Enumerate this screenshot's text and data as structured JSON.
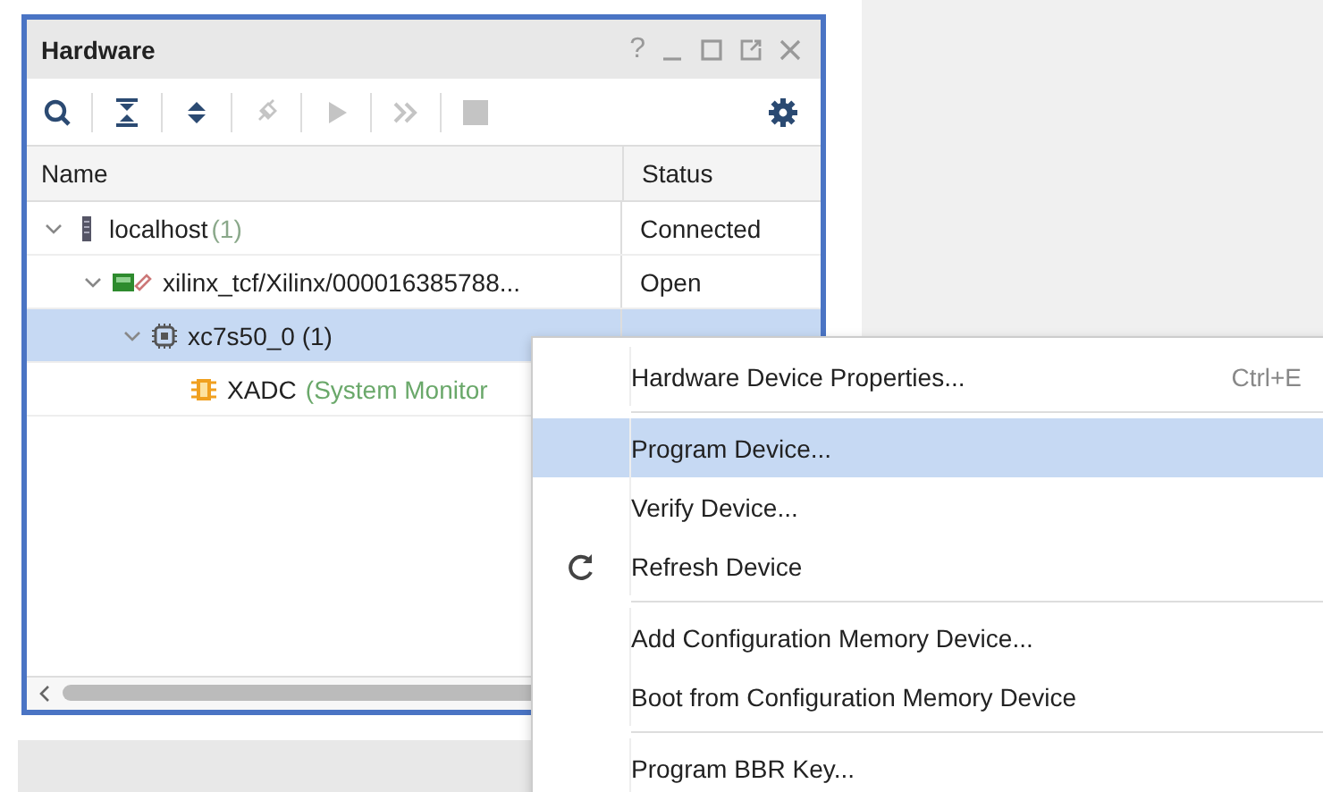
{
  "panel": {
    "title": "Hardware",
    "help": "?"
  },
  "toolbar": [
    {
      "kind": "search",
      "disabled": false
    },
    {
      "kind": "collapse",
      "disabled": false
    },
    {
      "kind": "expand",
      "disabled": false
    },
    {
      "kind": "connect",
      "disabled": true
    },
    {
      "kind": "run",
      "disabled": true
    },
    {
      "kind": "runall",
      "disabled": true
    },
    {
      "kind": "stop",
      "disabled": true
    },
    {
      "kind": "gear",
      "disabled": false
    }
  ],
  "table": {
    "columns": [
      "Name",
      "Status"
    ],
    "rows": [
      {
        "kind": "host",
        "name": "localhost",
        "count": "(1)",
        "status": "Connected",
        "selected": false,
        "expanded": true,
        "children": [
          {
            "kind": "target",
            "name": "xilinx_tcf/Xilinx/000016385788...",
            "status": "Open",
            "selected": false,
            "expanded": true,
            "children": [
              {
                "kind": "chip",
                "name": "xc7s50_0 (1)",
                "selected": true,
                "expanded": true,
                "children": [
                  {
                    "kind": "monitor",
                    "name": "XADC",
                    "note": "(System Monitor",
                    "selected": false
                  }
                ]
              }
            ]
          }
        ]
      }
    ]
  },
  "context_menu": [
    {
      "kind": "plain",
      "label": "Hardware Device Properties...",
      "shortcut": "Ctrl+E",
      "selected": false,
      "separator_after": true
    },
    {
      "kind": "plain",
      "label": "Program Device...",
      "selected": true,
      "separator_after": false
    },
    {
      "kind": "plain",
      "label": "Verify Device...",
      "selected": false,
      "separator_after": false
    },
    {
      "kind": "refresh",
      "label": "Refresh Device",
      "selected": false,
      "separator_after": true
    },
    {
      "kind": "plain",
      "label": "Add Configuration Memory Device...",
      "selected": false,
      "separator_after": false
    },
    {
      "kind": "plain",
      "label": "Boot from Configuration Memory Device",
      "selected": false,
      "separator_after": true
    },
    {
      "kind": "plain",
      "label": "Program BBR Key...",
      "selected": false,
      "separator_after": false
    }
  ]
}
